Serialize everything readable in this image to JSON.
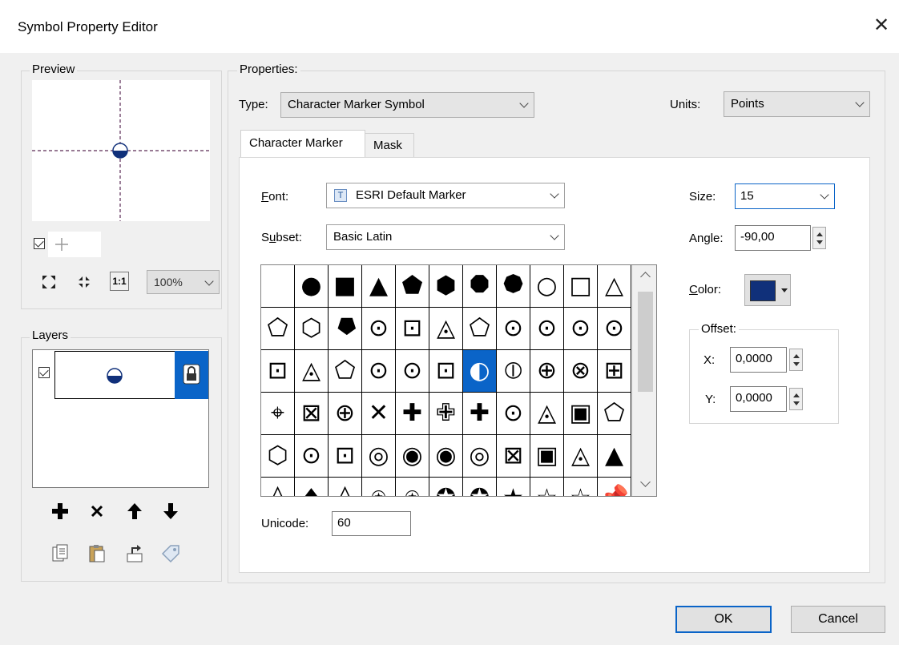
{
  "window": {
    "title": "Symbol Property Editor",
    "close_glyph": "✕"
  },
  "preview": {
    "group_label": "Preview",
    "zoom": "100%",
    "tool_icons": [
      "zoom-to-fit-icon",
      "fit-extent-icon",
      "actual-size-icon"
    ]
  },
  "layers": {
    "group_label": "Layers",
    "tool_icons": [
      "add-layer-icon",
      "delete-layer-icon",
      "move-up-icon",
      "move-down-icon",
      "copy-icon",
      "paste-icon",
      "reset-icon",
      "tag-icon"
    ]
  },
  "properties": {
    "group_label": "Properties:",
    "type_label": "Type:",
    "type_value": "Character Marker Symbol",
    "units_label": "Units:",
    "units_value": "Points"
  },
  "tabs": [
    {
      "label": "Character Marker",
      "active": true
    },
    {
      "label": "Mask",
      "active": false
    }
  ],
  "marker": {
    "font_label": "Font:",
    "font_value": "ESRI Default Marker",
    "subset_label": "Subset:",
    "subset_value": "Basic Latin",
    "size_label": "Size:",
    "size_value": "15",
    "angle_label": "Angle:",
    "angle_value": "-90,00",
    "color_label": "Color:",
    "color_value": "#10307a",
    "offset_label": "Offset:",
    "x_label": "X:",
    "x_value": "0,0000",
    "y_label": "Y:",
    "y_value": "0,0000",
    "unicode_label": "Unicode:",
    "unicode_value": "60"
  },
  "glyphs": [
    [
      "",
      "●",
      "■",
      "▲",
      "⬟",
      "⬢",
      "⯃",
      "⯄",
      "○",
      "□",
      "△"
    ],
    [
      "⬠",
      "⬡",
      "⯂",
      "⊙",
      "⊡",
      "◬",
      "⬠",
      "⊙",
      "⊙",
      "⊙",
      "⊙"
    ],
    [
      "⊡",
      "◬",
      "⬠",
      "⊙",
      "⊙",
      "⊡",
      "◐",
      "⦶",
      "⊕",
      "⊗",
      "⊞"
    ],
    [
      "⌖",
      "⊠",
      "⊕",
      "✕",
      "✚",
      "✙",
      "✚",
      "⊙",
      "◬",
      "▣",
      "⬠"
    ],
    [
      "⬡",
      "⊙",
      "⊡",
      "◎",
      "◉",
      "◉",
      "◎",
      "⊠",
      "▣",
      "◬",
      "▲"
    ],
    [
      "◊",
      "♦",
      "◊",
      "⍟",
      "⍟",
      "✪",
      "✪",
      "★",
      "☆",
      "☆",
      "📌"
    ]
  ],
  "selected_glyph": {
    "row": 2,
    "col": 6
  },
  "buttons": {
    "ok": "OK",
    "cancel": "Cancel"
  }
}
